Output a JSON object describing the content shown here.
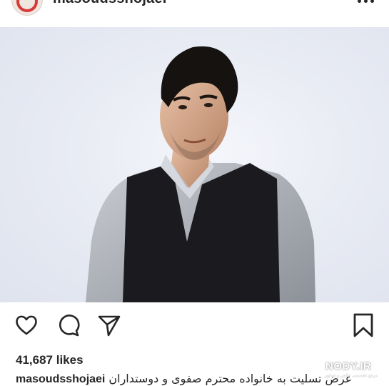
{
  "post": {
    "header": {
      "username": "masoudsshojaei",
      "more_icon": "more-horizontal-icon"
    },
    "photo": {
      "subject": "portrait-photo"
    },
    "actions": {
      "like_icon": "heart-icon",
      "comment_icon": "comment-icon",
      "share_icon": "send-icon",
      "save_icon": "bookmark-icon"
    },
    "likes": "41,687 likes",
    "caption": {
      "username": "masoudsshojaei",
      "text": "عرض تسلیت به خانواده محترم صفوی و دوستداران"
    }
  },
  "watermark": {
    "brand": "NODY.IR",
    "tagline": "مرجع تخصصی عکس و تصاویر"
  },
  "colors": {
    "text": "#262626",
    "background": "#ffffff"
  }
}
